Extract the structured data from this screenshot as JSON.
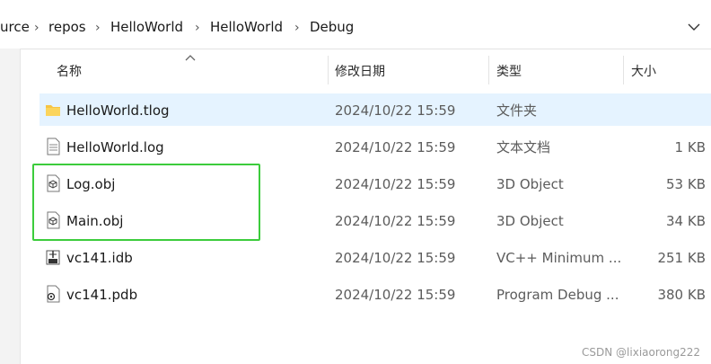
{
  "breadcrumb": {
    "items": [
      "urce",
      "repos",
      "HelloWorld",
      "HelloWorld",
      "Debug"
    ],
    "separator": "›"
  },
  "columns": {
    "name": "名称",
    "date": "修改日期",
    "type": "类型",
    "size": "大小"
  },
  "files": [
    {
      "name": "HelloWorld.tlog",
      "date": "2024/10/22 15:59",
      "type": "文件夹",
      "size": "",
      "icon": "folder-icon",
      "selected": true
    },
    {
      "name": "HelloWorld.log",
      "date": "2024/10/22 15:59",
      "type": "文本文档",
      "size": "1 KB",
      "icon": "text-file-icon",
      "selected": false
    },
    {
      "name": "Log.obj",
      "date": "2024/10/22 15:59",
      "type": "3D Object",
      "size": "53 KB",
      "icon": "3d-object-icon",
      "selected": false
    },
    {
      "name": "Main.obj",
      "date": "2024/10/22 15:59",
      "type": "3D Object",
      "size": "34 KB",
      "icon": "3d-object-icon",
      "selected": false
    },
    {
      "name": "vc141.idb",
      "date": "2024/10/22 15:59",
      "type": "VC++ Minimum ...",
      "size": "251 KB",
      "icon": "idb-file-icon",
      "selected": false
    },
    {
      "name": "vc141.pdb",
      "date": "2024/10/22 15:59",
      "type": "Program Debug ...",
      "size": "380 KB",
      "icon": "pdb-file-icon",
      "selected": false
    }
  ],
  "watermark": "CSDN @lixiaorong222",
  "colors": {
    "selection": "#e5f3ff",
    "highlight": "#3ccc3c",
    "folder": "#f7c443"
  }
}
